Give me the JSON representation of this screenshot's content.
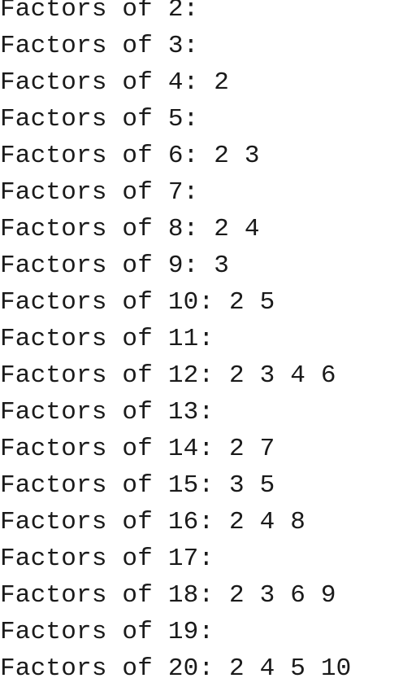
{
  "output": {
    "lines": [
      "Factors of 2:",
      "Factors of 3:",
      "Factors of 4: 2",
      "Factors of 5:",
      "Factors of 6: 2 3",
      "Factors of 7:",
      "Factors of 8: 2 4",
      "Factors of 9: 3",
      "Factors of 10: 2 5",
      "Factors of 11:",
      "Factors of 12: 2 3 4 6",
      "Factors of 13:",
      "Factors of 14: 2 7",
      "Factors of 15: 3 5",
      "Factors of 16: 2 4 8",
      "Factors of 17:",
      "Factors of 18: 2 3 6 9",
      "Factors of 19:",
      "Factors of 20: 2 4 5 10"
    ]
  }
}
